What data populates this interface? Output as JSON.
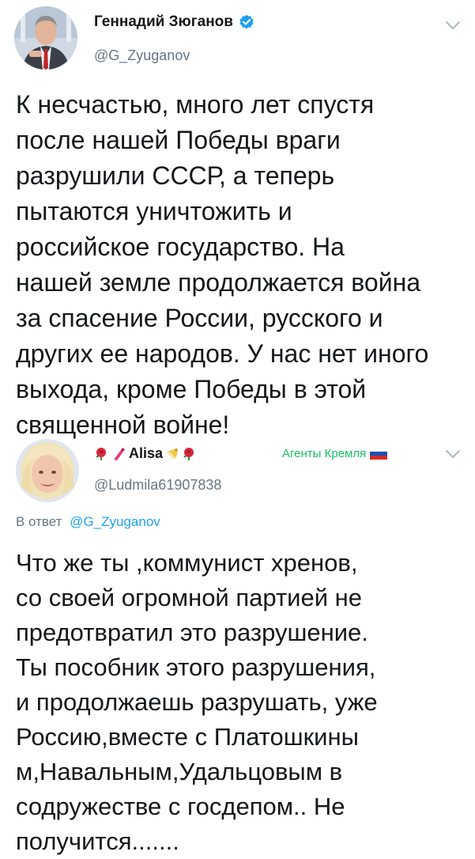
{
  "tweets": [
    {
      "author": {
        "display_name": "Геннадий Зюганов",
        "handle": "@G_Zyuganov",
        "verified": true,
        "avatar_icon": "avatar-photo-man-in-suit"
      },
      "text": "К несчастью, много лет спустя\nпосле нашей Победы враги\nразрушили СССР, а теперь\nпытаются уничтожить и\nроссийское государство. На\nнашей земле продолжается война\nза спасение России, русского и\nдругих ее народов. У нас нет иного\nвыхода, кроме Победы в этой\nсвященной войне!"
    },
    {
      "author": {
        "display_name": "Alisa",
        "handle": "@Ludmila61907838",
        "verified": false,
        "avatar_icon": "avatar-photo-blonde-woman",
        "name_emojis": [
          "rose-icon",
          "lipstick-icon",
          "nail-polish-icon",
          "rose-icon"
        ]
      },
      "agents_label": "Агенты Кремля",
      "agents_flag": "russia-flag-icon",
      "reply_prefix": "В ответ",
      "reply_to": "@G_Zyuganov",
      "text": "Что же ты ,коммунист хренов,\nсо своей огромной партией не\nпредотвратил это разрушение.\nТы пособник этого разрушения,\nи продолжаешь разрушать, уже\nРоссию,вместе с Платошкины\nм,Навальным,Удальцовым в\nсодружестве с госдепом.. Не\nполучится......."
    }
  ],
  "colors": {
    "text": "#14171a",
    "secondary": "#657786",
    "link": "#1da1f2",
    "verified": "#1da1f2",
    "agents_label": "#17bf63"
  }
}
